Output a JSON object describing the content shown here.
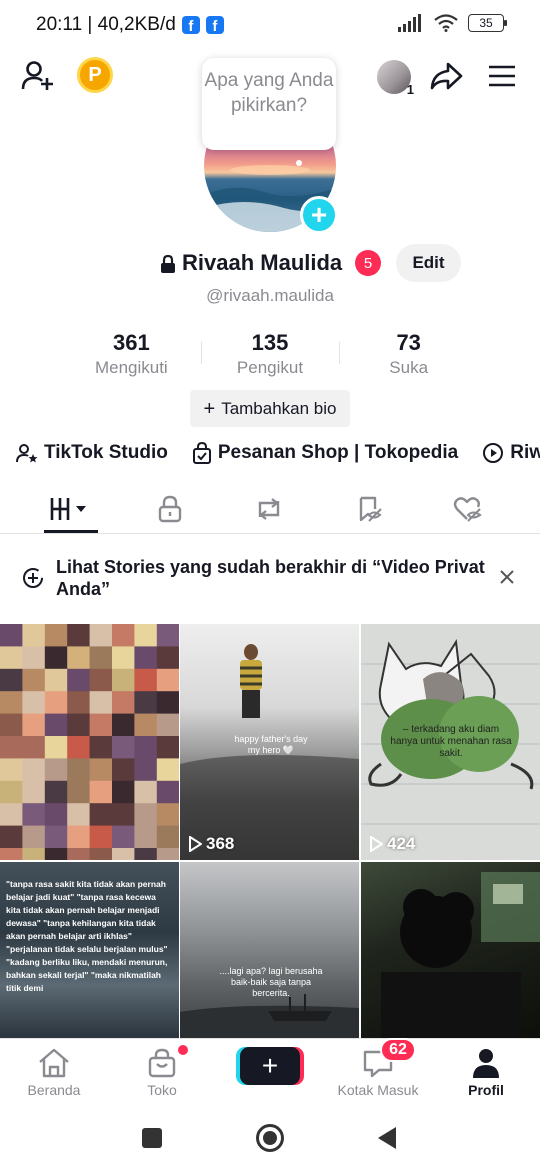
{
  "status_bar": {
    "time_data": "20:11 | 40,2KB/d",
    "battery": "35"
  },
  "bubble": {
    "text": "Apa yang Anda pikirkan?"
  },
  "profile": {
    "username": "Rivaah Maulida",
    "notification_count": "5",
    "edit_label": "Edit",
    "handle": "@rivaah.maulida",
    "stats": [
      {
        "value": "361",
        "label": "Mengikuti"
      },
      {
        "value": "135",
        "label": "Pengikut"
      },
      {
        "value": "73",
        "label": "Suka"
      }
    ],
    "bio_button": "Tambahkan bio",
    "avatar_notif": "1"
  },
  "links": [
    {
      "label": "TikTok Studio",
      "icon": "person-star-icon"
    },
    {
      "label": "Pesanan Shop | Tokopedia",
      "icon": "bag-check-icon"
    },
    {
      "label": "Riwa",
      "icon": "play-circle-icon"
    }
  ],
  "stories_banner": {
    "text": "Lihat Stories yang sudah berakhir di “Video Privat Anda”"
  },
  "videos": [
    {
      "plays": ""
    },
    {
      "plays": "368",
      "caption": "happy father's day my hero 🤍"
    },
    {
      "plays": "424",
      "caption": "– terkadang aku diam hanya untuk menahan rasa sakit."
    },
    {
      "plays": "",
      "caption": "\"tanpa rasa sakit kita tidak akan pernah belajar jadi kuat\" \"tanpa rasa kecewa kita tidak akan pernah belajar menjadi dewasa\" \"tanpa kehilangan kita tidak akan pernah belajar arti ikhlas\" \"perjalanan tidak selalu berjalan mulus\" \"kadang berliku liku, mendaki menurun, bahkan sekali terjal\" \"maka nikmatilah titik demi"
    },
    {
      "plays": "",
      "caption": "....lagi apa? lagi berusaha baik-baik saja tanpa bercerita."
    },
    {
      "plays": ""
    }
  ],
  "bottom_nav": {
    "items": [
      "Beranda",
      "Toko",
      "",
      "Kotak Masuk",
      "Profil"
    ],
    "inbox_badge": "62",
    "create_label": "+"
  },
  "colors": {
    "accent_red": "#fe2c55",
    "accent_cyan": "#20d5ec",
    "text_primary": "#161823",
    "text_secondary": "#8a8b91"
  }
}
